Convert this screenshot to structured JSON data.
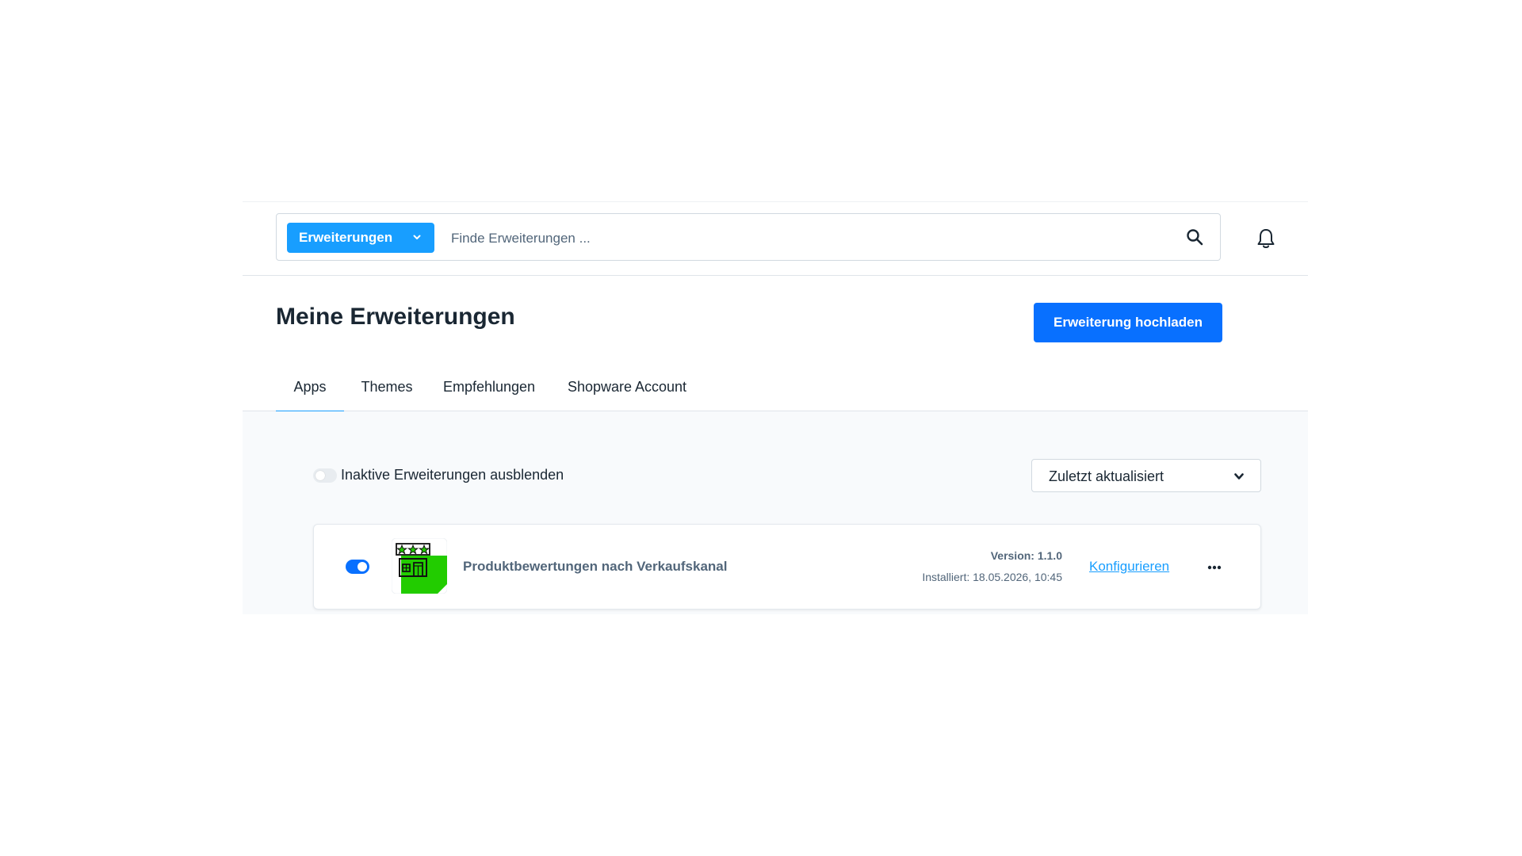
{
  "search": {
    "type_label": "Erweiterungen",
    "placeholder": "Finde Erweiterungen ..."
  },
  "header": {
    "title": "Meine Erweiterungen",
    "upload_label": "Erweiterung hochladen"
  },
  "tabs": [
    {
      "label": "Apps",
      "active": true
    },
    {
      "label": "Themes",
      "active": false
    },
    {
      "label": "Empfehlungen",
      "active": false
    },
    {
      "label": "Shopware Account",
      "active": false
    }
  ],
  "filter": {
    "hide_inactive_label": "Inaktive Erweiterungen ausblenden",
    "hide_inactive_on": false,
    "sort_value": "Zuletzt aktualisiert"
  },
  "extensions": [
    {
      "name": "Produktbewertungen nach Verkaufskanal",
      "active": true,
      "version": "Version: 1.1.0",
      "installed": "Installiert: 18.05.2026, 10:45",
      "configure_label": "Konfigurieren",
      "icon": "store-rating-icon"
    }
  ],
  "colors": {
    "primary": "#0870ff",
    "accent": "#189eff",
    "text": "#1a2733",
    "muted": "#52667a",
    "icon_green": "#22cc00"
  }
}
